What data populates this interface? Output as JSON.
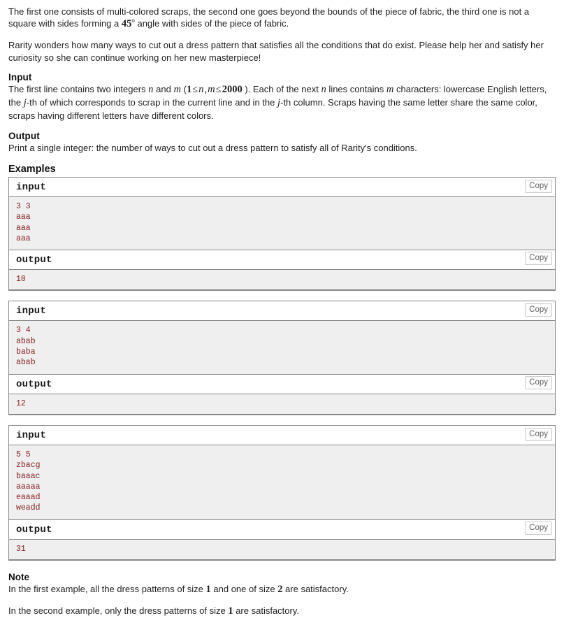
{
  "statement": {
    "paragraphs": [
      "The first one consists of multi-colored scraps, the second one goes beyond the bounds of the piece of fabric, the third one is not a square with sides forming a ",
      " angle with sides of the piece of fabric.",
      "Rarity wonders how many ways to cut out a dress pattern that satisfies all the conditions that do exist. Please help her and satisfy her curiosity so she can continue working on her new masterpiece!"
    ],
    "angle": "45",
    "degree_symbol": "o"
  },
  "input_section": {
    "title": "Input",
    "text_1": "The first line contains two integers ",
    "var_n": "n",
    "text_2": " and ",
    "var_m": "m",
    "text_3": " (",
    "bound_low": "1",
    "leq_1": "≤",
    "var_n2": "n",
    "comma": ",",
    "var_m2": "m",
    "leq_2": "≤",
    "bound_high": "2000",
    "text_4": " ). Each of the next ",
    "var_n3": "n",
    "text_5": " lines contains ",
    "var_m3": "m",
    "text_6": " characters: lowercase English letters, the ",
    "var_j": "j",
    "text_7": "-th of which corresponds to scrap in the current line and in the ",
    "var_j2": "j",
    "text_8": "-th column. Scraps having the same letter share the same color, scraps having different letters have different colors."
  },
  "output_section": {
    "title": "Output",
    "text": "Print a single integer: the number of ways to cut out a dress pattern to satisfy all of Rarity's conditions."
  },
  "examples": {
    "title": "Examples",
    "input_label": "input",
    "output_label": "output",
    "copy_label": "Copy",
    "tests": [
      {
        "input": "3 3\naaa\naaa\naaa",
        "output": "10"
      },
      {
        "input": "3 4\nabab\nbaba\nabab",
        "output": "12"
      },
      {
        "input": "5 5\nzbacg\nbaaac\naaaaa\neaaad\nweadd",
        "output": "31"
      }
    ]
  },
  "note": {
    "title": "Note",
    "line1_a": "In the first example, all the dress patterns of size ",
    "line1_size1": "1",
    "line1_b": " and one of size ",
    "line1_size2": "2",
    "line1_c": " are satisfactory.",
    "line2_a": "In the second example, only the dress patterns of size ",
    "line2_size1": "1",
    "line2_b": " are satisfactory."
  },
  "colors": {
    "sample_data_text": "#8b2020",
    "sample_data_bg": "#efefef",
    "border": "#888888",
    "body_text": "#1f1f1f"
  }
}
